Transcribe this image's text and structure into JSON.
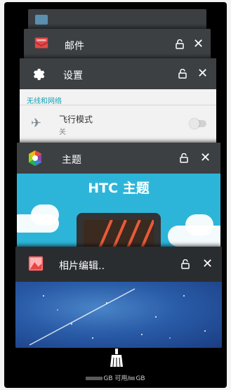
{
  "recent_apps": [
    {
      "title": "",
      "icon": "app-icon"
    },
    {
      "title": "邮件",
      "icon": "mail-icon"
    },
    {
      "title": "设置",
      "icon": "gear-icon",
      "content": {
        "section": "无线和网络",
        "item_title": "飞行模式",
        "item_sub": "关"
      }
    },
    {
      "title": "主题",
      "icon": "theme-icon",
      "content": {
        "banner": "HTC 主题"
      }
    },
    {
      "title": "相片编辑..",
      "icon": "photo-editor-icon"
    }
  ],
  "footer": {
    "storage_text_a": "GB 可用/",
    "storage_text_b": "GB"
  },
  "colors": {
    "accent": "#16a2b6",
    "theme_bg": "#2db5d9",
    "header_dark": "#3d4043"
  }
}
